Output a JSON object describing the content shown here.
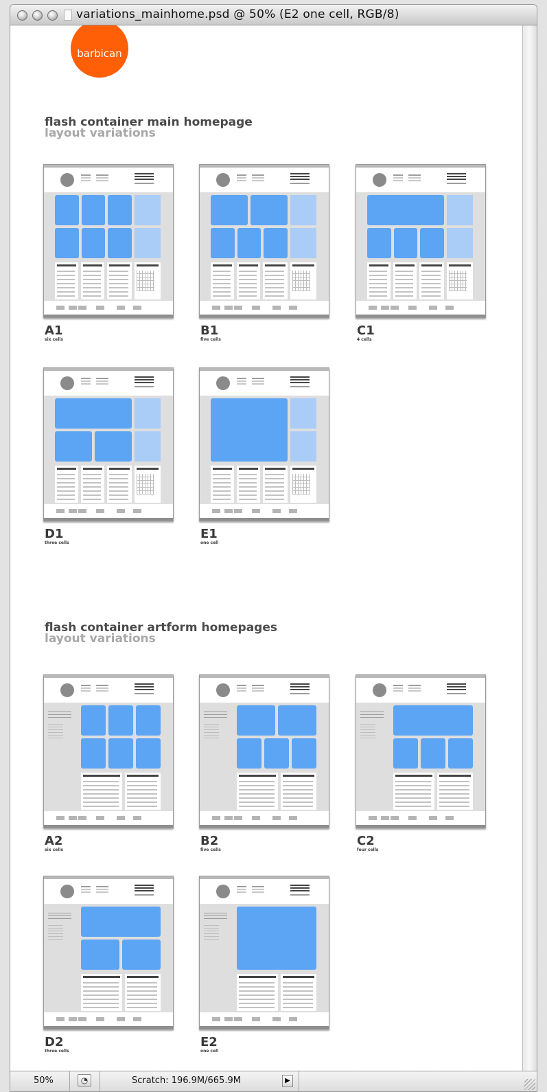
{
  "window": {
    "title": "variations_mainhome.psd @ 50% (E2 one cell, RGB/8)"
  },
  "logo": {
    "text": "barbican",
    "color": "#ff5f06"
  },
  "sections": [
    {
      "title": "flash container main homepage",
      "subtitle": "layout variations",
      "variations": [
        {
          "code": "A1",
          "caption": "six cells",
          "layout": "six"
        },
        {
          "code": "B1",
          "caption": "five cells",
          "layout": "five"
        },
        {
          "code": "C1",
          "caption": "4 cells",
          "layout": "four"
        },
        {
          "code": "D1",
          "caption": "three cells",
          "layout": "three"
        },
        {
          "code": "E1",
          "caption": "one cell",
          "layout": "one"
        }
      ]
    },
    {
      "title": "flash container artform homepages",
      "subtitle": "layout variations",
      "variations": [
        {
          "code": "A2",
          "caption": "six cells",
          "layout": "six"
        },
        {
          "code": "B2",
          "caption": "five cells",
          "layout": "five"
        },
        {
          "code": "C2",
          "caption": "four cells",
          "layout": "four"
        },
        {
          "code": "D2",
          "caption": "three cells",
          "layout": "three"
        },
        {
          "code": "E2",
          "caption": "one cell",
          "layout": "one"
        }
      ]
    }
  ],
  "status": {
    "zoom": "50%",
    "scratch": "Scratch: 196.9M/665.9M"
  },
  "colors": {
    "cell": "#5ca4f4",
    "cell_light": "#aacdf8"
  },
  "icons": {
    "window_controls": [
      "close-icon",
      "minimize-icon",
      "zoom-icon"
    ],
    "document": "document-icon",
    "navigator": "navigator-icon",
    "status_menu": "triangle-right-icon",
    "resize": "resize-grip-icon"
  }
}
